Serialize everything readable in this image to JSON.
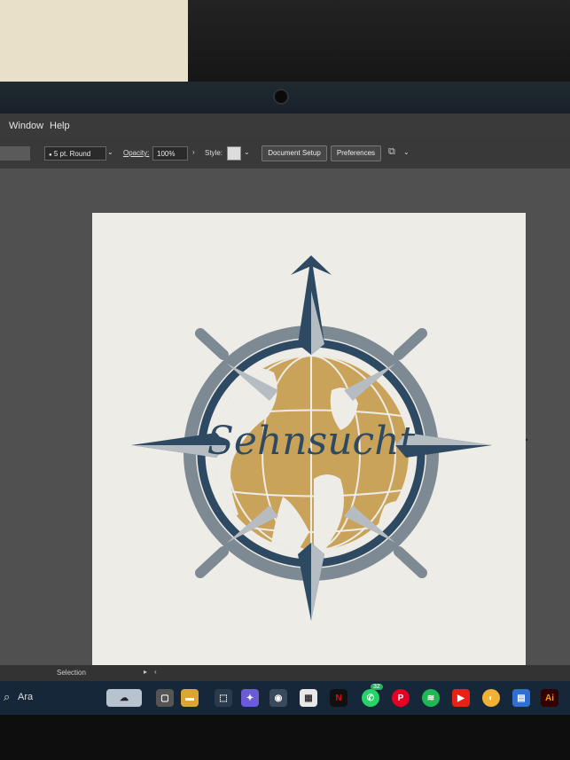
{
  "menu": {
    "window_label": "Window",
    "help_label": "Help"
  },
  "control_bar": {
    "stroke_profile": "5 pt. Round",
    "opacity_label": "Opacity:",
    "opacity_value": "100%",
    "style_label": "Style:",
    "document_setup_label": "Document Setup",
    "preferences_label": "Preferences"
  },
  "artwork": {
    "title": "Sehnsucht"
  },
  "status_bar": {
    "tool_label": "Selection"
  },
  "taskbar": {
    "search_label": "Ara",
    "whatsapp_badge": "32",
    "illustrator_label": "Ai"
  },
  "colors": {
    "navy": "#2e4a63",
    "slate": "#7d8a93",
    "light_slate": "#b5bcc2",
    "gold": "#c9a35a",
    "artboard": "#eeece6"
  }
}
